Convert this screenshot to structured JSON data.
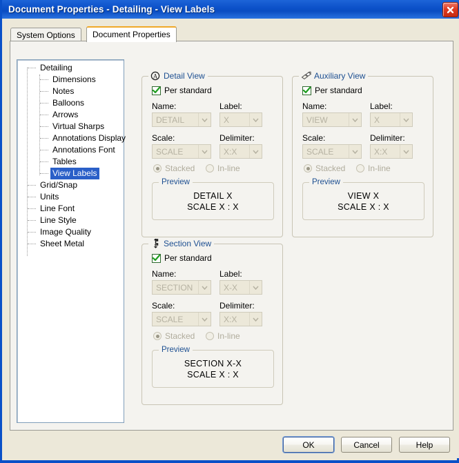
{
  "window": {
    "title": "Document Properties - Detailing - View Labels",
    "close_icon": "close-icon"
  },
  "tabs": [
    {
      "label": "System Options",
      "active": false
    },
    {
      "label": "Document Properties",
      "active": true
    }
  ],
  "tree": {
    "nodes": [
      {
        "label": "Detailing",
        "level": 0,
        "selected": false
      },
      {
        "label": "Dimensions",
        "level": 1,
        "selected": false
      },
      {
        "label": "Notes",
        "level": 1,
        "selected": false
      },
      {
        "label": "Balloons",
        "level": 1,
        "selected": false
      },
      {
        "label": "Arrows",
        "level": 1,
        "selected": false
      },
      {
        "label": "Virtual Sharps",
        "level": 1,
        "selected": false
      },
      {
        "label": "Annotations Display",
        "level": 1,
        "selected": false
      },
      {
        "label": "Annotations Font",
        "level": 1,
        "selected": false
      },
      {
        "label": "Tables",
        "level": 1,
        "selected": false
      },
      {
        "label": "View Labels",
        "level": 1,
        "selected": true
      },
      {
        "label": "Grid/Snap",
        "level": 0,
        "selected": false
      },
      {
        "label": "Units",
        "level": 0,
        "selected": false
      },
      {
        "label": "Line Font",
        "level": 0,
        "selected": false
      },
      {
        "label": "Line Style",
        "level": 0,
        "selected": false
      },
      {
        "label": "Image Quality",
        "level": 0,
        "selected": false
      },
      {
        "label": "Sheet Metal",
        "level": 0,
        "selected": false
      }
    ]
  },
  "groups": {
    "detail": {
      "title": "Detail View",
      "icon": "detail-view-icon",
      "per_standard_label": "Per standard",
      "per_standard_checked": true,
      "name_label": "Name:",
      "name_value": "DETAIL",
      "label_label": "Label:",
      "label_value": "X",
      "scale_label": "Scale:",
      "scale_value": "SCALE",
      "delimiter_label": "Delimiter:",
      "delimiter_value": "X:X",
      "stacked_label": "Stacked",
      "inline_label": "In-line",
      "stacked_selected": true,
      "preview_title": "Preview",
      "preview_line1": "DETAIL X",
      "preview_line2": "SCALE X : X"
    },
    "auxiliary": {
      "title": "Auxiliary View",
      "icon": "auxiliary-view-icon",
      "per_standard_label": "Per standard",
      "per_standard_checked": true,
      "name_label": "Name:",
      "name_value": "VIEW",
      "label_label": "Label:",
      "label_value": "X",
      "scale_label": "Scale:",
      "scale_value": "SCALE",
      "delimiter_label": "Delimiter:",
      "delimiter_value": "X:X",
      "stacked_label": "Stacked",
      "inline_label": "In-line",
      "stacked_selected": true,
      "preview_title": "Preview",
      "preview_line1": "VIEW X",
      "preview_line2": "SCALE X : X"
    },
    "section": {
      "title": "Section View",
      "icon": "section-view-icon",
      "per_standard_label": "Per standard",
      "per_standard_checked": true,
      "name_label": "Name:",
      "name_value": "SECTION",
      "label_label": "Label:",
      "label_value": "X-X",
      "scale_label": "Scale:",
      "scale_value": "SCALE",
      "delimiter_label": "Delimiter:",
      "delimiter_value": "X:X",
      "stacked_label": "Stacked",
      "inline_label": "In-line",
      "stacked_selected": true,
      "preview_title": "Preview",
      "preview_line1": "SECTION X-X",
      "preview_line2": "SCALE X : X"
    }
  },
  "footer": {
    "ok": "OK",
    "cancel": "Cancel",
    "help": "Help"
  },
  "colors": {
    "titlebar": "#0b50c8",
    "accent_tab": "#f0a828",
    "caption_text": "#1d4f91",
    "selection": "#2a5fc8",
    "dialog_bg": "#ece8d9",
    "panel_bg": "#f4f3ef",
    "check_green": "#2e9e2e"
  }
}
